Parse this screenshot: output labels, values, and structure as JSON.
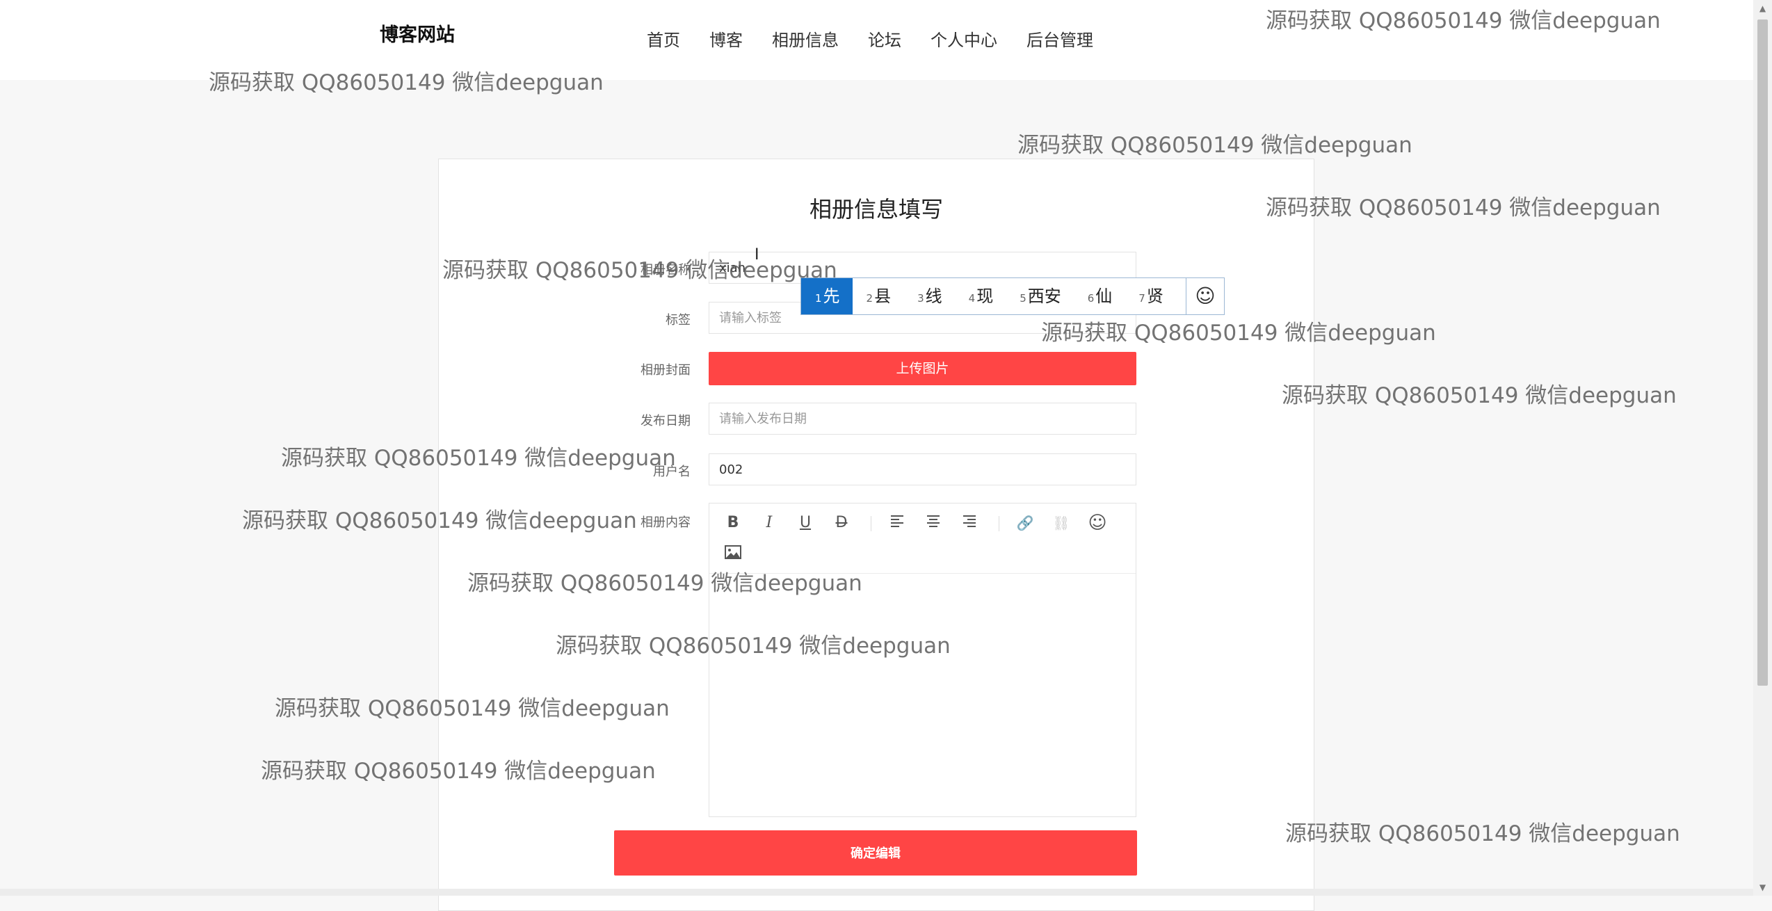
{
  "header": {
    "brand": "博客网站",
    "nav": [
      "首页",
      "博客",
      "相册信息",
      "论坛",
      "个人中心",
      "后台管理"
    ]
  },
  "form": {
    "title": "相册信息填写",
    "name_label": "相册名称",
    "name_value": "xian",
    "tag_label": "标签",
    "tag_placeholder": "请输入标签",
    "cover_label": "相册封面",
    "upload_label": "上传图片",
    "date_label": "发布日期",
    "date_placeholder": "请输入发布日期",
    "user_label": "用户名",
    "user_value": "002",
    "content_label": "相册内容",
    "submit_label": "确定编辑"
  },
  "toolbar_icons": [
    "bold-icon",
    "italic-icon",
    "underline-icon",
    "strikethrough-icon",
    "align-left-icon",
    "align-center-icon",
    "align-right-icon",
    "link-icon",
    "unlink-icon",
    "emoji-icon",
    "image-icon"
  ],
  "ime": {
    "candidates": [
      {
        "index": "1",
        "text": "先"
      },
      {
        "index": "2",
        "text": "县"
      },
      {
        "index": "3",
        "text": "线"
      },
      {
        "index": "4",
        "text": "现"
      },
      {
        "index": "5",
        "text": "西安"
      },
      {
        "index": "6",
        "text": "仙"
      },
      {
        "index": "7",
        "text": "贤"
      }
    ],
    "emoji": "☺"
  },
  "watermark": "源码获取 QQ86050149 微信deepguan",
  "colors": {
    "accent": "#ff4545",
    "ime_selected": "#1470c8",
    "page_bg": "#f7f7f7"
  }
}
